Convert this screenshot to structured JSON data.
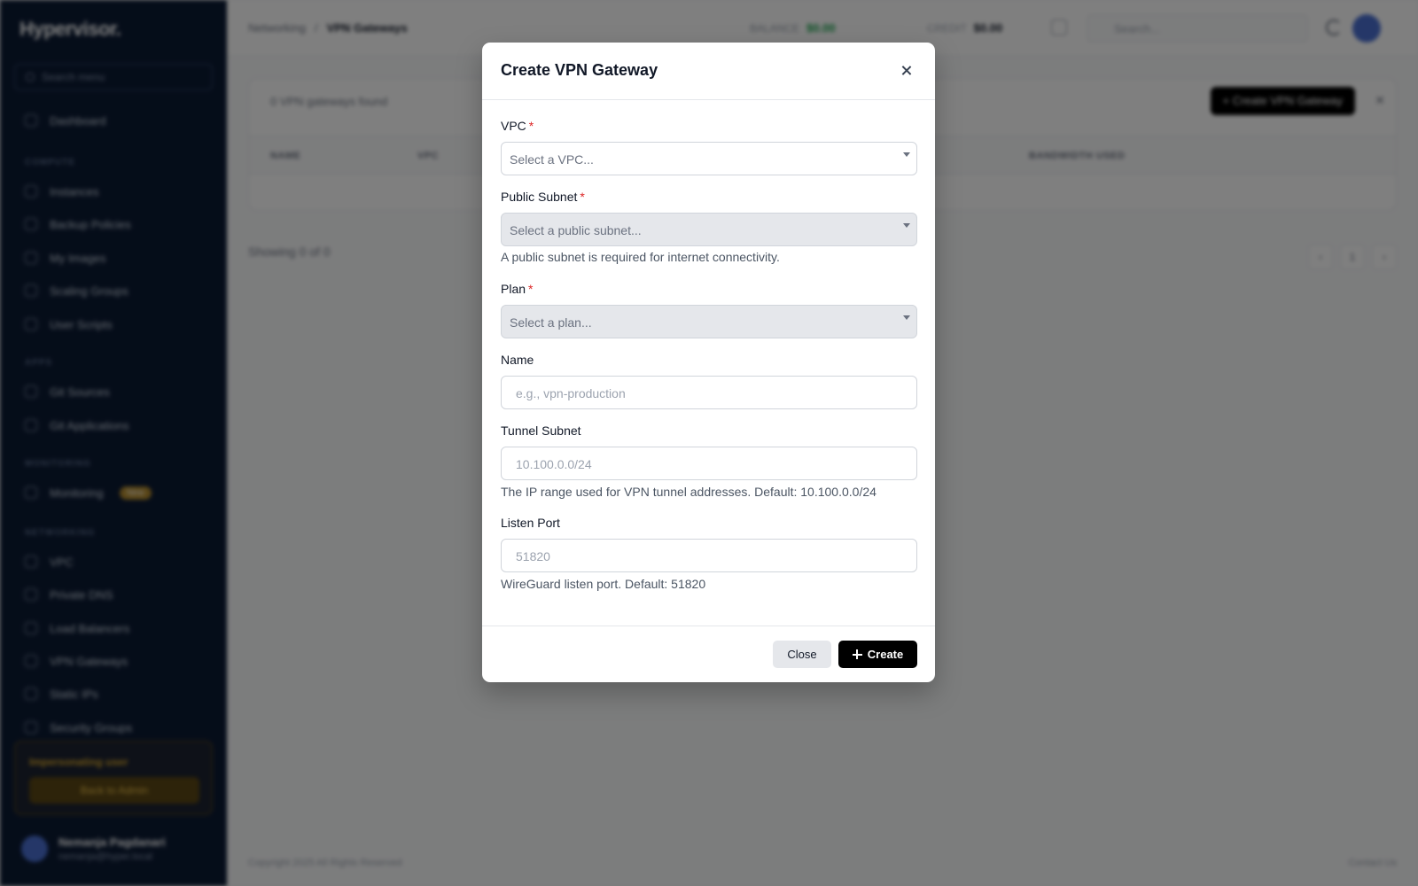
{
  "sidebar": {
    "logo": "Hypervisor.",
    "search_placeholder": "Search menu",
    "sections": [
      "COMPUTE",
      "APPS",
      "MONITORING",
      "NETWORKING"
    ],
    "compute_items": [
      "Instances",
      "Backup Policies",
      "My Images",
      "Scaling Groups",
      "User Scripts"
    ],
    "apps_items": [
      "Git Sources",
      "Git Applications"
    ],
    "monitoring_items": [
      "Monitoring"
    ],
    "monitoring_badge": "New",
    "networking_items": [
      "VPC",
      "Private DNS",
      "Load Balancers",
      "VPN Gateways",
      "Static IPs",
      "Security Groups"
    ],
    "impersonate_text": "Impersonating user",
    "impersonate_button": "Back to Admin",
    "user_name": "Nemanja Pagdanari",
    "user_email": "nemanja@hyper.local"
  },
  "topbar": {
    "breadcrumb": [
      "Networking",
      "VPN Gateways"
    ],
    "balance_label": "BALANCE",
    "balance_value": "$0.00",
    "credit_label": "CREDIT",
    "credit_value": "$0.00",
    "search_placeholder": "Search..."
  },
  "content": {
    "count_text": "0 VPN gateways found",
    "create_button": "+ Create VPN Gateway",
    "columns": [
      "NAME",
      "VPC",
      "BANDWIDTH USED"
    ],
    "showing": "Showing 0 of 0",
    "page": "1",
    "copyright": "Copyright 2025 All Rights Reserved",
    "footer_link": "Contact Us"
  },
  "modal": {
    "title": "Create VPN Gateway",
    "vpc": {
      "label": "VPC",
      "required_mark": "*",
      "placeholder": "Select a VPC..."
    },
    "public_subnet": {
      "label": "Public Subnet",
      "required_mark": "*",
      "placeholder": "Select a public subnet...",
      "help": "A public subnet is required for internet connectivity."
    },
    "plan": {
      "label": "Plan",
      "required_mark": "*",
      "placeholder": "Select a plan..."
    },
    "name": {
      "label": "Name",
      "placeholder": "e.g., vpn-production"
    },
    "tunnel_subnet": {
      "label": "Tunnel Subnet",
      "placeholder": "10.100.0.0/24",
      "help": "The IP range used for VPN tunnel addresses. Default: 10.100.0.0/24"
    },
    "listen_port": {
      "label": "Listen Port",
      "placeholder": "51820",
      "help": "WireGuard listen port. Default: 51820"
    },
    "close_button": "Close",
    "create_button": "Create"
  }
}
